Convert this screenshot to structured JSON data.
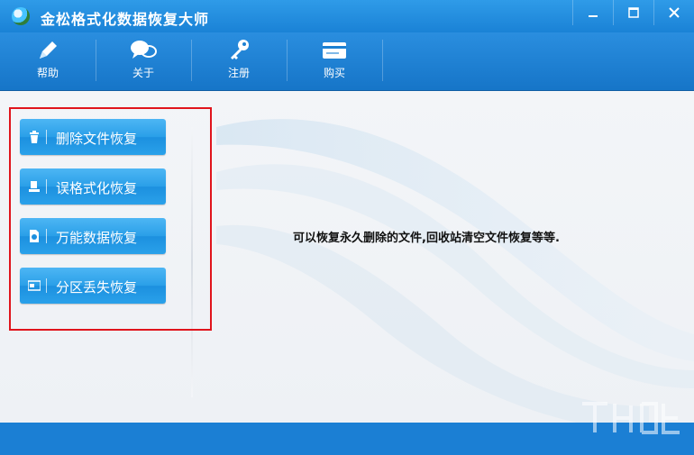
{
  "window": {
    "title": "金松格式化数据恢复大师",
    "controls": [
      "minimize",
      "maximize",
      "close"
    ]
  },
  "toolbar": {
    "items": [
      {
        "label": "帮助",
        "icon": "pen-icon"
      },
      {
        "label": "关于",
        "icon": "chat-bubbles-icon"
      },
      {
        "label": "注册",
        "icon": "key-icon"
      },
      {
        "label": "购买",
        "icon": "credit-card-icon"
      }
    ]
  },
  "actions": [
    {
      "label": "删除文件恢复",
      "icon": "trash-icon"
    },
    {
      "label": "误格式化恢复",
      "icon": "format-icon"
    },
    {
      "label": "万能数据恢复",
      "icon": "document-recover-icon"
    },
    {
      "label": "分区丢失恢复",
      "icon": "partition-icon"
    }
  ],
  "main": {
    "description": "可以恢复永久删除的文件,回收站清空文件恢复等等."
  },
  "colors": {
    "titlebar": "#2a8edf",
    "button": "#2aa1ea",
    "highlight_border": "#e0141c",
    "statusbar": "#1b7fd4"
  }
}
